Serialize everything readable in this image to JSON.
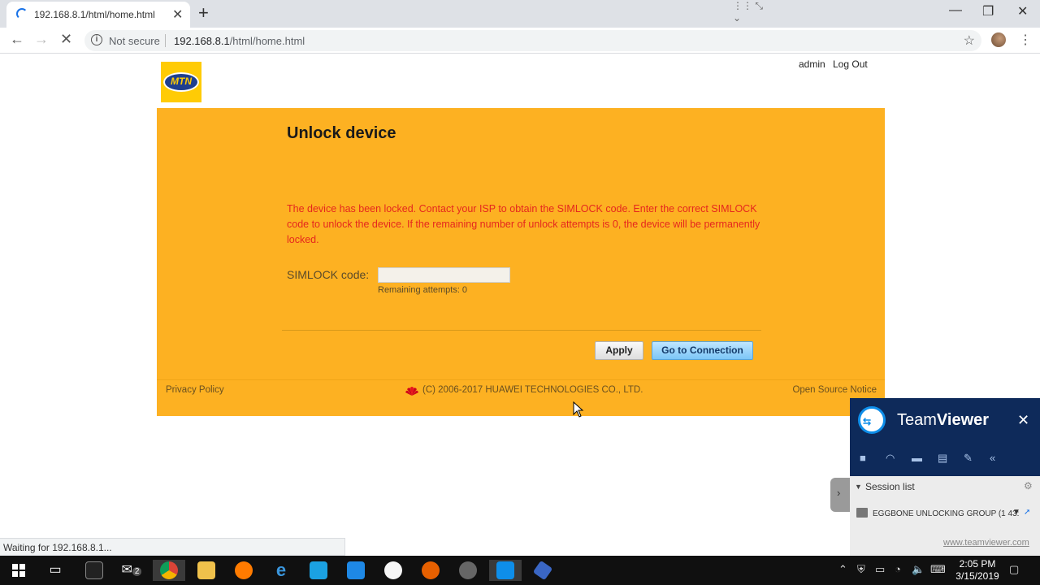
{
  "browser": {
    "tab_title": "192.168.8.1/html/home.html",
    "tab_close": "✕",
    "new_tab": "+",
    "not_secure": "Not secure",
    "url_host": "192.168.8.1",
    "url_path": "/html/home.html",
    "window_controls": {
      "minimize": "—",
      "restore": "❐",
      "close": "✕"
    },
    "status": "Waiting for 192.168.8.1..."
  },
  "header": {
    "logo_text": "MTN",
    "user": "admin",
    "logout": "Log Out"
  },
  "unlock": {
    "title": "Unlock device",
    "warning": "The device has been locked. Contact your ISP to obtain the SIMLOCK code. Enter the correct SIMLOCK code to unlock the device. If the remaining number of unlock attempts is 0, the device will be permanently locked.",
    "simlock_label": "SIMLOCK code:",
    "simlock_value": "",
    "remaining": "Remaining attempts:  0",
    "apply": "Apply",
    "go_connection": "Go to Connection"
  },
  "footer": {
    "privacy": "Privacy Policy",
    "copyright": "(C) 2006-2017 HUAWEI TECHNOLOGIES CO., LTD.",
    "open_source": "Open Source Notice"
  },
  "teamviewer": {
    "title_a": "Team",
    "title_b": "Viewer",
    "close": "✕",
    "session_list": "Session list",
    "session_item": "EGGBONE UNLOCKING GROUP (1 43:",
    "link": "www.teamviewer.com"
  },
  "taskbar": {
    "mail_badge": "2",
    "time": "2:05 PM",
    "date": "3/15/2019"
  },
  "colors": {
    "panel": "#fdb122",
    "warning": "#e5271e",
    "mtn_yellow": "#ffcb05",
    "teamviewer_blue": "#0e2a5a"
  }
}
